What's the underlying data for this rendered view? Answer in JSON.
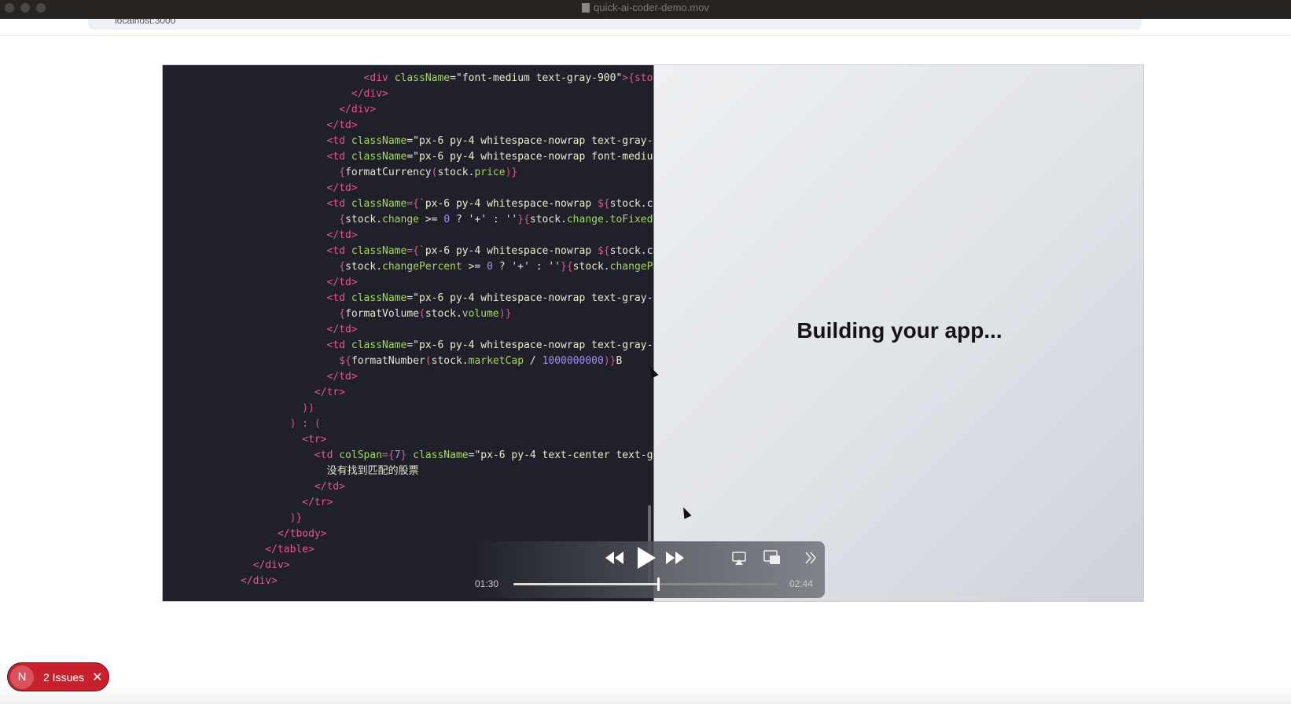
{
  "window": {
    "title": "quick-ai-coder-demo.mov"
  },
  "browser": {
    "url": "localhost:3000"
  },
  "code": {
    "lines": [
      [
        [
          "                    ",
          "txt"
        ],
        [
          "<div ",
          "tag"
        ],
        [
          "className",
          "attr"
        ],
        [
          "=\"font-medium text-gray-900\"",
          "str"
        ],
        [
          ">{sto",
          "brace"
        ]
      ],
      [
        [
          "                  ",
          "txt"
        ],
        [
          "</div>",
          "tag"
        ]
      ],
      [
        [
          "                ",
          "txt"
        ],
        [
          "</div>",
          "tag"
        ]
      ],
      [
        [
          "              ",
          "txt"
        ],
        [
          "</td>",
          "tag"
        ]
      ],
      [
        [
          "              ",
          "txt"
        ],
        [
          "<td ",
          "tag"
        ],
        [
          "className",
          "attr"
        ],
        [
          "=\"px-6 py-4 whitespace-nowrap text-gray-",
          "str"
        ]
      ],
      [
        [
          "              ",
          "txt"
        ],
        [
          "<td ",
          "tag"
        ],
        [
          "className",
          "attr"
        ],
        [
          "=\"px-6 py-4 whitespace-nowrap font-mediu",
          "str"
        ]
      ],
      [
        [
          "                ",
          "txt"
        ],
        [
          "{",
          "brace"
        ],
        [
          "formatCurrency",
          "txt"
        ],
        [
          "(",
          "brace"
        ],
        [
          "stock.",
          "txt"
        ],
        [
          "price",
          "prop"
        ],
        [
          ")}",
          "brace"
        ]
      ],
      [
        [
          "              ",
          "txt"
        ],
        [
          "</td>",
          "tag"
        ]
      ],
      [
        [
          "              ",
          "txt"
        ],
        [
          "<td ",
          "tag"
        ],
        [
          "className",
          "attr"
        ],
        [
          "={`",
          "brace"
        ],
        [
          "px-6 py-4 whitespace-nowrap ",
          "str"
        ],
        [
          "${",
          "brace"
        ],
        [
          "stock.c",
          "txt"
        ]
      ],
      [
        [
          "                ",
          "txt"
        ],
        [
          "{",
          "brace"
        ],
        [
          "stock.",
          "txt"
        ],
        [
          "change",
          "prop"
        ],
        [
          " >= ",
          "txt"
        ],
        [
          "0",
          "num"
        ],
        [
          " ? '+' : ''",
          "txt"
        ],
        [
          "}{",
          "brace"
        ],
        [
          "stock.",
          "txt"
        ],
        [
          "change.toFixed",
          "prop"
        ]
      ],
      [
        [
          "              ",
          "txt"
        ],
        [
          "</td>",
          "tag"
        ]
      ],
      [
        [
          "              ",
          "txt"
        ],
        [
          "<td ",
          "tag"
        ],
        [
          "className",
          "attr"
        ],
        [
          "={`",
          "brace"
        ],
        [
          "px-6 py-4 whitespace-nowrap ",
          "str"
        ],
        [
          "${",
          "brace"
        ],
        [
          "stock.c",
          "txt"
        ]
      ],
      [
        [
          "                ",
          "txt"
        ],
        [
          "{",
          "brace"
        ],
        [
          "stock.",
          "txt"
        ],
        [
          "changePercent",
          "prop"
        ],
        [
          " >= ",
          "txt"
        ],
        [
          "0",
          "num"
        ],
        [
          " ? '+' : ''",
          "txt"
        ],
        [
          "}{",
          "brace"
        ],
        [
          "stock.",
          "txt"
        ],
        [
          "changeP",
          "prop"
        ]
      ],
      [
        [
          "              ",
          "txt"
        ],
        [
          "</td>",
          "tag"
        ]
      ],
      [
        [
          "              ",
          "txt"
        ],
        [
          "<td ",
          "tag"
        ],
        [
          "className",
          "attr"
        ],
        [
          "=\"px-6 py-4 whitespace-nowrap text-gray-",
          "str"
        ]
      ],
      [
        [
          "                ",
          "txt"
        ],
        [
          "{",
          "brace"
        ],
        [
          "formatVolume",
          "txt"
        ],
        [
          "(",
          "brace"
        ],
        [
          "stock.",
          "txt"
        ],
        [
          "volume",
          "prop"
        ],
        [
          ")}",
          "brace"
        ]
      ],
      [
        [
          "              ",
          "txt"
        ],
        [
          "</td>",
          "tag"
        ]
      ],
      [
        [
          "              ",
          "txt"
        ],
        [
          "<td ",
          "tag"
        ],
        [
          "className",
          "attr"
        ],
        [
          "=\"px-6 py-4 whitespace-nowrap text-gray-",
          "str"
        ]
      ],
      [
        [
          "                ",
          "txt"
        ],
        [
          "${",
          "brace"
        ],
        [
          "formatNumber",
          "txt"
        ],
        [
          "(",
          "brace"
        ],
        [
          "stock.",
          "txt"
        ],
        [
          "marketCap",
          "prop"
        ],
        [
          " / ",
          "txt"
        ],
        [
          "1000000000",
          "num"
        ],
        [
          ")}",
          "brace"
        ],
        [
          "B",
          "txt"
        ]
      ],
      [
        [
          "              ",
          "txt"
        ],
        [
          "</td>",
          "tag"
        ]
      ],
      [
        [
          "            ",
          "txt"
        ],
        [
          "</tr>",
          "tag"
        ]
      ],
      [
        [
          "          ",
          "txt"
        ],
        [
          "))",
          "brace"
        ]
      ],
      [
        [
          "        ",
          "txt"
        ],
        [
          ") : (",
          "brace"
        ]
      ],
      [
        [
          "          ",
          "txt"
        ],
        [
          "<tr>",
          "tag"
        ]
      ],
      [
        [
          "            ",
          "txt"
        ],
        [
          "<td ",
          "tag"
        ],
        [
          "colSpan",
          "attr"
        ],
        [
          "={",
          "brace"
        ],
        [
          "7",
          "num"
        ],
        [
          "} ",
          "brace"
        ],
        [
          "className",
          "attr"
        ],
        [
          "=\"px-6 py-4 text-center text-g",
          "str"
        ]
      ],
      [
        [
          "              ",
          "txt"
        ],
        [
          "没有找到匹配的股票",
          "txt"
        ]
      ],
      [
        [
          "            ",
          "txt"
        ],
        [
          "</td>",
          "tag"
        ]
      ],
      [
        [
          "          ",
          "txt"
        ],
        [
          "</tr>",
          "tag"
        ]
      ],
      [
        [
          "        ",
          "txt"
        ],
        [
          ")}",
          "brace"
        ]
      ],
      [
        [
          "      ",
          "txt"
        ],
        [
          "</tbody>",
          "tag"
        ]
      ],
      [
        [
          "    ",
          "txt"
        ],
        [
          "</table>",
          "tag"
        ]
      ],
      [
        [
          "  ",
          "txt"
        ],
        [
          "</div>",
          "tag"
        ]
      ],
      [
        [
          "",
          "txt"
        ],
        [
          "</div>",
          "tag"
        ]
      ]
    ]
  },
  "preview": {
    "status": "Building your app..."
  },
  "player": {
    "current_time": "01:30",
    "duration": "02:44",
    "progress": 0.549,
    "icons": [
      "rewind-icon",
      "play-icon",
      "fast-forward-icon",
      "airplay-icon",
      "picture-in-picture-icon",
      "more-icon"
    ]
  },
  "issues_badge": {
    "logo": "N",
    "label": "2 Issues",
    "close": "✕"
  },
  "colors": {
    "badge": "#c9202e",
    "editor_bg": "#1f2029"
  }
}
